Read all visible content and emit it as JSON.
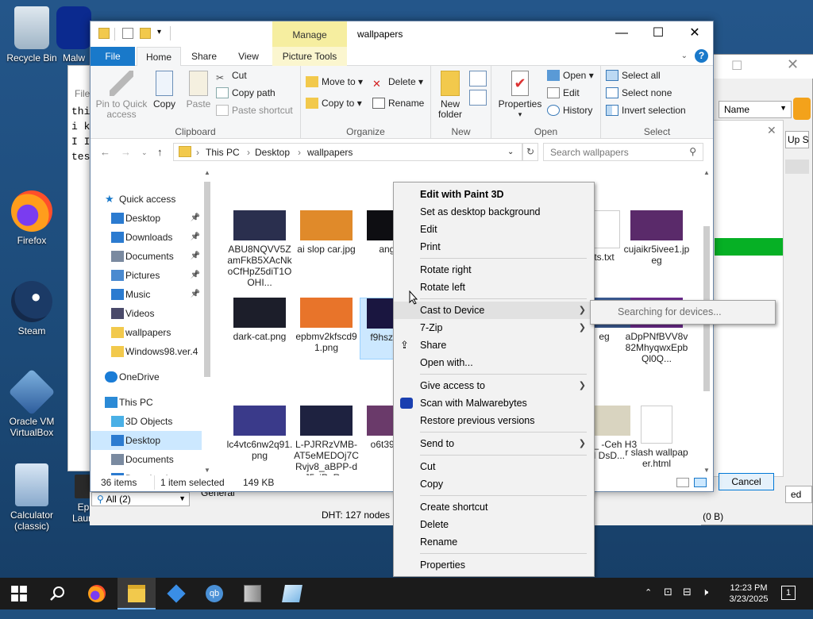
{
  "desktop": {
    "icons": [
      {
        "label": "Recycle Bin",
        "icon": "recycle-bin-icon"
      },
      {
        "label": "Malw",
        "icon": "malwarebytes-icon"
      },
      {
        "label": "Firefox",
        "icon": "firefox-icon"
      },
      {
        "label": "Steam",
        "icon": "steam-icon"
      },
      {
        "label": "Oracle VM VirtualBox",
        "icon": "virtualbox-icon"
      },
      {
        "label": "Calculator (classic)",
        "icon": "calculator-icon"
      },
      {
        "label": "Epic ... Launcher",
        "icon": "epic-games-icon"
      }
    ]
  },
  "background_window": {
    "notepad_lines": [
      "thi",
      "i k",
      "I I",
      "tes"
    ],
    "notepad_menu": "File",
    "name_column": "Name",
    "up_label": "Up S",
    "cancel_label": "Cancel",
    "filter_value": "All (2)",
    "general_tab": "General",
    "dht_status": "DHT: 127 nodes",
    "speed_status": "0 B/s (0 B)",
    "ed_label": "ed"
  },
  "explorer": {
    "title": "wallpapers",
    "manage_tab": "Manage",
    "tabs": [
      "File",
      "Home",
      "Share",
      "View",
      "Picture Tools"
    ],
    "help": "?",
    "ribbon": {
      "clipboard": {
        "label": "Clipboard",
        "pin": "Pin to Quick access",
        "copy": "Copy",
        "paste": "Paste",
        "cut": "Cut",
        "copy_path": "Copy path",
        "paste_shortcut": "Paste shortcut"
      },
      "organize": {
        "label": "Organize",
        "move_to": "Move to",
        "copy_to": "Copy to",
        "delete": "Delete",
        "rename": "Rename"
      },
      "new": {
        "label": "New",
        "new_folder": "New folder"
      },
      "open": {
        "label": "Open",
        "properties": "Properties",
        "open": "Open",
        "edit": "Edit",
        "history": "History"
      },
      "select": {
        "label": "Select",
        "select_all": "Select all",
        "select_none": "Select none",
        "invert": "Invert selection"
      }
    },
    "address": {
      "crumbs": [
        "This PC",
        "Desktop",
        "wallpapers"
      ],
      "search_placeholder": "Search wallpapers"
    },
    "nav": [
      {
        "label": "Quick access",
        "icon": "star-icon",
        "indent": 0,
        "pinned": false
      },
      {
        "label": "Desktop",
        "icon": "desktop-folder-icon",
        "indent": 1,
        "pinned": true
      },
      {
        "label": "Downloads",
        "icon": "downloads-icon",
        "indent": 1,
        "pinned": true
      },
      {
        "label": "Documents",
        "icon": "documents-icon",
        "indent": 1,
        "pinned": true
      },
      {
        "label": "Pictures",
        "icon": "pictures-icon",
        "indent": 1,
        "pinned": true
      },
      {
        "label": "Music",
        "icon": "music-icon",
        "indent": 1,
        "pinned": true
      },
      {
        "label": "Videos",
        "icon": "videos-icon",
        "indent": 1,
        "pinned": false
      },
      {
        "label": "wallpapers",
        "icon": "folder-icon",
        "indent": 1,
        "pinned": false
      },
      {
        "label": "Windows98.ver.4",
        "icon": "folder-icon",
        "indent": 1,
        "pinned": false
      },
      {
        "label": "OneDrive",
        "icon": "onedrive-icon",
        "indent": 0,
        "pinned": false
      },
      {
        "label": "This PC",
        "icon": "this-pc-icon",
        "indent": 0,
        "pinned": false
      },
      {
        "label": "3D Objects",
        "icon": "3d-objects-icon",
        "indent": 1,
        "pinned": false
      },
      {
        "label": "Desktop",
        "icon": "desktop-folder-icon",
        "indent": 1,
        "pinned": false
      },
      {
        "label": "Documents",
        "icon": "documents-icon",
        "indent": 1,
        "pinned": false
      },
      {
        "label": "Downloads",
        "icon": "downloads-icon",
        "indent": 1,
        "pinned": false
      }
    ],
    "files": [
      {
        "name": "ABU8NQVV5ZamFkB5XAcNkoCfHpZ5diT1OOHI...",
        "color": "#2a2f4e",
        "col": 0,
        "row": 0
      },
      {
        "name": "ai slop car.jpg",
        "color": "#e08a2a",
        "col": 1,
        "row": 0
      },
      {
        "name": "angy c",
        "color": "#0e0e12",
        "col": 2,
        "row": 0
      },
      {
        "name": "ts.txt",
        "color": "#ffffff",
        "col": 5,
        "row": 0
      },
      {
        "name": "cujaikr5ivee1.jpeg",
        "color": "#5a2a6a",
        "col": 6,
        "row": 0
      },
      {
        "name": "dark-cat.png",
        "color": "#1c1e2a",
        "col": 0,
        "row": 1
      },
      {
        "name": "epbmv2kfscd91.png",
        "color": "#e8742a",
        "col": 1,
        "row": 1
      },
      {
        "name": "f9hszz 1.jp",
        "color": "#1a1640",
        "col": 2,
        "row": 1
      },
      {
        "name": "eg",
        "color": "#3a5a90",
        "col": 5,
        "row": 1
      },
      {
        "name": "aDpPNfBVV8v82MhyqwxEpbQl0Q...",
        "color": "#6a2a8a",
        "col": 6,
        "row": 1
      },
      {
        "name": "lc4vtc6nw2q91.png",
        "color": "#3a3a8a",
        "col": 0,
        "row": 2
      },
      {
        "name": "L-PJRRzVMB-AT5eMEDOj7CRvjv8_aBPP-dJ5xjPeR...",
        "color": "#1e2240",
        "col": 1,
        "row": 2
      },
      {
        "name": "o6t39 q91.",
        "color": "#6a3a6a",
        "col": 2,
        "row": 2
      },
      {
        "name": "dFTu_ -Ceh H35N DsD...",
        "color": "#d9d4c0",
        "col": 5,
        "row": 2
      },
      {
        "name": "r slash wallpaper.html",
        "color": "#ffffff",
        "col": 6,
        "row": 2
      }
    ],
    "status": {
      "count": "36 items",
      "selected": "1 item selected",
      "size": "149 KB"
    }
  },
  "context_menu": {
    "items": [
      {
        "label": "Edit with Paint 3D",
        "bold": true
      },
      {
        "label": "Set as desktop background"
      },
      {
        "label": "Edit"
      },
      {
        "label": "Print"
      },
      {
        "sep": true
      },
      {
        "label": "Rotate right"
      },
      {
        "label": "Rotate left"
      },
      {
        "sep": true
      },
      {
        "label": "Cast to Device",
        "arrow": true,
        "hl": true
      },
      {
        "label": "7-Zip",
        "arrow": true
      },
      {
        "label": "Share",
        "icon": "share-icon"
      },
      {
        "label": "Open with..."
      },
      {
        "sep": true
      },
      {
        "label": "Give access to",
        "arrow": true
      },
      {
        "label": "Scan with Malwarebytes",
        "icon": "malwarebytes-icon"
      },
      {
        "label": "Restore previous versions"
      },
      {
        "sep": true
      },
      {
        "label": "Send to",
        "arrow": true
      },
      {
        "sep": true
      },
      {
        "label": "Cut"
      },
      {
        "label": "Copy"
      },
      {
        "sep": true
      },
      {
        "label": "Create shortcut"
      },
      {
        "label": "Delete"
      },
      {
        "label": "Rename"
      },
      {
        "sep": true
      },
      {
        "label": "Properties"
      }
    ],
    "submenu": "Searching for devices..."
  },
  "taskbar": {
    "time": "12:23 PM",
    "date": "3/23/2025",
    "notification_count": "1",
    "apps": [
      "windows-start-icon",
      "search-icon",
      "firefox-icon",
      "file-explorer-icon",
      "visual-studio-icon",
      "qbittorrent-icon",
      "archive-icon",
      "notepad-icon"
    ]
  },
  "colors": {
    "accent": "#1979ca",
    "selection": "#cce8ff",
    "manage_tab": "#f6eea0",
    "menu_bg": "#f2f2f2"
  }
}
